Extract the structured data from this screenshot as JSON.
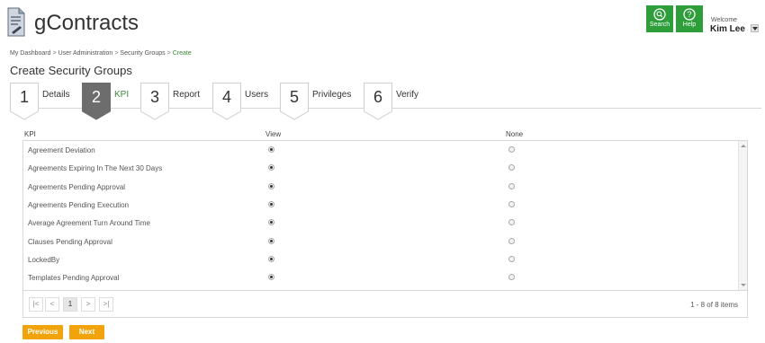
{
  "app": {
    "name": "gContracts"
  },
  "header": {
    "search_label": "Search",
    "help_label": "Help",
    "welcome": "Welcome",
    "username": "Kim Lee"
  },
  "breadcrumb": [
    "My Dashboard",
    "User Administration",
    "Security Groups",
    "Create"
  ],
  "page_title": "Create Security Groups",
  "steps": [
    {
      "num": "1",
      "label": "Details"
    },
    {
      "num": "2",
      "label": "KPI",
      "active": true
    },
    {
      "num": "3",
      "label": "Report"
    },
    {
      "num": "4",
      "label": "Users"
    },
    {
      "num": "5",
      "label": "Privileges"
    },
    {
      "num": "6",
      "label": "Verify"
    }
  ],
  "grid": {
    "columns": [
      "KPI",
      "View",
      "None"
    ],
    "rows": [
      {
        "kpi": "Agreement Deviation",
        "selected": "View"
      },
      {
        "kpi": "Agreements Expiring In The Next 30 Days",
        "selected": "View"
      },
      {
        "kpi": "Agreements Pending Approval",
        "selected": "View"
      },
      {
        "kpi": "Agreements Pending Execution",
        "selected": "View"
      },
      {
        "kpi": "Average Agreement Turn Around Time",
        "selected": "View"
      },
      {
        "kpi": "Clauses Pending Approval",
        "selected": "View"
      },
      {
        "kpi": "LockedBy",
        "selected": "View"
      },
      {
        "kpi": "Templates Pending Approval",
        "selected": "View"
      }
    ]
  },
  "pager": {
    "first": "|<",
    "prev": "<",
    "page": "1",
    "next": ">",
    "last": ">|",
    "info": "1 - 8 of 8 items"
  },
  "actions": {
    "previous": "Previous",
    "next": "Next"
  },
  "colors": {
    "accent_green": "#2e9e3a",
    "action_orange": "#f0a30a",
    "active_step": "#6d6d6d"
  }
}
